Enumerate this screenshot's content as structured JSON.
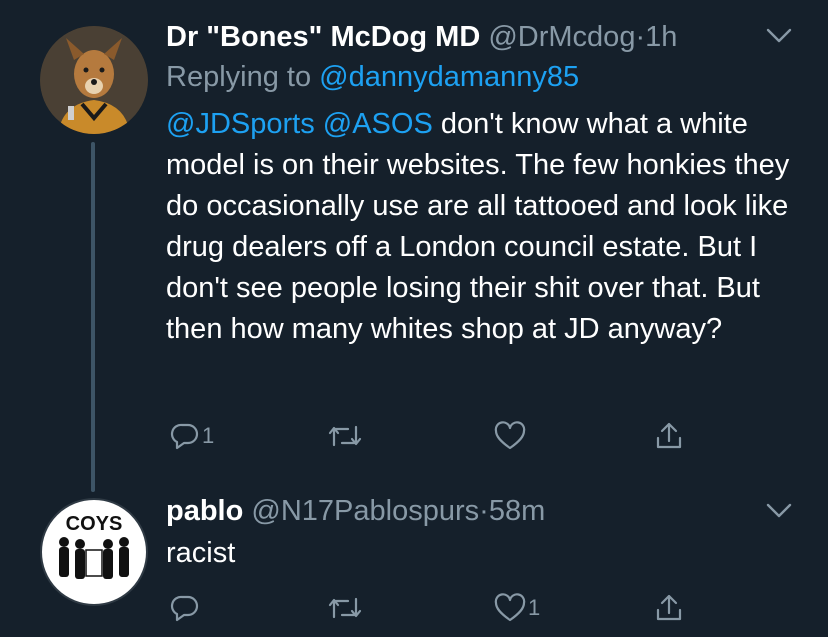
{
  "tweet1": {
    "display_name": "Dr \"Bones\" McDog MD",
    "handle": "@DrMcdog",
    "separator": "·",
    "time": "1h",
    "replying_prefix": "Replying to ",
    "replying_handle": "@dannydamanny85",
    "mention1": "@JDSports",
    "mention2": "@ASOS",
    "text": " don't know what a white model is on their websites. The few honkies they do occasionally use are all tattooed and look like drug dealers off a London council estate. But I don't see people losing their shit over that. But then how many whites shop at JD anyway?",
    "reply_count": "1",
    "retweet_count": "",
    "like_count": ""
  },
  "tweet2": {
    "display_name": "pablo",
    "handle": "@N17Pablospurs",
    "separator": "·",
    "time": "58m",
    "text": "racist",
    "avatar_text": "COYS",
    "reply_count": "",
    "retweet_count": "",
    "like_count": "1"
  },
  "colors": {
    "background": "#15202b",
    "text_primary": "#ffffff",
    "text_secondary": "#8899a6",
    "link": "#1da1f2",
    "thread_line": "#3d5466"
  },
  "icons": [
    "reply-icon",
    "retweet-icon",
    "like-icon",
    "share-icon",
    "chevron-down-icon"
  ]
}
